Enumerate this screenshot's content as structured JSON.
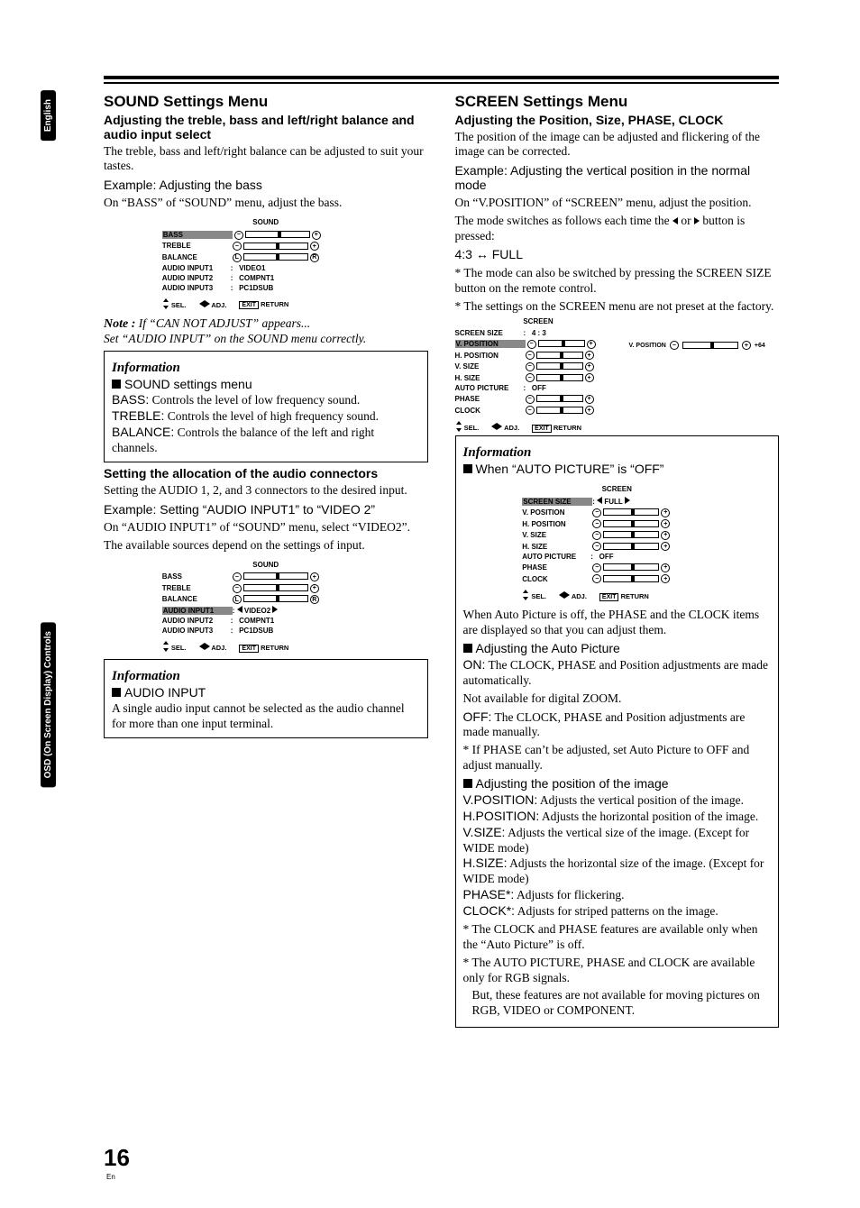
{
  "tabs": {
    "english": "English",
    "osd": "OSD (On Screen Display) Controls"
  },
  "L": {
    "h": "SOUND Settings Menu",
    "sub": "Adjusting the treble, bass and left/right balance and audio input select",
    "p1": "The treble, bass and left/right balance can be adjusted to suit your tastes.",
    "ex1": "Example: Adjusting the bass",
    "p2": "On “BASS” of “SOUND” menu, adjust the bass.",
    "osd1": {
      "title": "SOUND",
      "rows": [
        "BASS",
        "TREBLE",
        "BALANCE",
        "AUDIO INPUT1",
        "AUDIO INPUT2",
        "AUDIO INPUT3"
      ],
      "vals": [
        "",
        "",
        "",
        "VIDEO1",
        "COMPNT1",
        "PC1DSUB"
      ],
      "sel": "SEL.",
      "adj": "ADJ.",
      "ret": "RETURN",
      "exit": "EXIT"
    },
    "noteLabel": "Note :",
    "note1": "If “CAN NOT ADJUST” appears...",
    "note2": "Set “AUDIO INPUT” on the SOUND menu correctly.",
    "info": "Information",
    "ssm": "SOUND settings menu",
    "bass": "BASS:",
    "bassTx": " Controls the level of low frequency sound.",
    "treb": "TREBLE:",
    "trebTx": " Controls the level of high frequency sound.",
    "bal": "BALANCE:",
    "balTx": " Controls the balance of the left and right channels.",
    "h2": "Setting the allocation of the audio connectors",
    "p3": "Setting the AUDIO 1, 2, and 3 connectors to the desired input.",
    "ex2": "Example: Setting “AUDIO INPUT1” to “VIDEO 2”",
    "p4": "On “AUDIO INPUT1” of “SOUND” menu, select “VIDEO2”.",
    "p5": "The available sources depend on the settings of input.",
    "osd2": {
      "title": "SOUND",
      "rows": [
        "BASS",
        "TREBLE",
        "BALANCE",
        "AUDIO INPUT1",
        "AUDIO INPUT2",
        "AUDIO INPUT3"
      ],
      "vals": [
        "",
        "",
        "",
        "VIDEO2",
        "COMPNT1",
        "PC1DSUB"
      ]
    },
    "aih": "AUDIO INPUT",
    "aip": "A single audio input cannot be selected as the audio channel for more than one input terminal."
  },
  "R": {
    "h": "SCREEN Settings Menu",
    "sub": "Adjusting the Position, Size, PHASE, CLOCK",
    "p1": "The position of the image can be adjusted and flickering of the image can be corrected.",
    "ex1": "Example: Adjusting the vertical position in the normal mode",
    "p2": "On “V.POSITION” of “SCREEN” menu, adjust the position.",
    "p3a": "The mode switches as follows each time the ",
    "p3b": " or ",
    "p3c": " button is pressed:",
    "modes": "4:3 ↔ FULL",
    "b1": "The mode can also be switched by pressing the SCREEN SIZE button on the remote control.",
    "b2": "The settings on the SCREEN menu are not preset at the factory.",
    "osd1": {
      "title": "SCREEN",
      "rows": [
        "SCREEN SIZE",
        "V. POSITION",
        "H. POSITION",
        "V. SIZE",
        "H. SIZE",
        "AUTO PICTURE",
        "PHASE",
        "CLOCK"
      ],
      "vals": [
        "4 : 3",
        "",
        "",
        "",
        "",
        "OFF",
        "",
        ""
      ],
      "side": "V. POSITION",
      "sideVal": "+64"
    },
    "info": "Information",
    "when": "When “AUTO PICTURE” is “OFF”",
    "osd2": {
      "title": "SCREEN",
      "rows": [
        "SCREEN SIZE",
        "V. POSITION",
        "H. POSITION",
        "V. SIZE",
        "H. SIZE",
        "AUTO PICTURE",
        "PHASE",
        "CLOCK"
      ],
      "vals": [
        "FULL",
        "",
        "",
        "",
        "",
        "OFF",
        "",
        ""
      ]
    },
    "pAP": "When Auto Picture is off, the PHASE and the CLOCK items are displayed so that you can adjust them.",
    "aap": "Adjusting the Auto Picture",
    "on": "ON:",
    "onTx": " The CLOCK, PHASE and Position adjustments are made automatically.",
    "noz": "Not available for digital ZOOM.",
    "off": "OFF:",
    "offTx": " The CLOCK, PHASE and Position adjustments are made manually.",
    "star": "* If PHASE can’t be adjusted, set Auto Picture to OFF and adjust manually.",
    "api": "Adjusting the position of the image",
    "vp": "V.POSITION:",
    "vpTx": " Adjusts the vertical position of the image.",
    "hp": "H.POSITION:",
    "hpTx": " Adjusts the horizontal position of the image.",
    "vs": "V.SIZE:",
    "vsTx": " Adjusts the vertical size of the image. (Except for WIDE mode)",
    "hs": "H.SIZE:",
    "hsTx": " Adjusts the horizontal size of the image. (Except for WIDE mode)",
    "ph": "PHASE*:",
    "phTx": " Adjusts for flickering.",
    "cl": "CLOCK*:",
    "clTx": " Adjusts for striped patterns on the image.",
    "s2": "* The CLOCK and PHASE features are available only when the “Auto Picture” is off.",
    "s3": "* The AUTO PICTURE, PHASE and CLOCK are available only for RGB signals.",
    "s4": "But, these features are not available for moving pictures on RGB, VIDEO or COMPONENT."
  },
  "page": "16",
  "en": "En"
}
